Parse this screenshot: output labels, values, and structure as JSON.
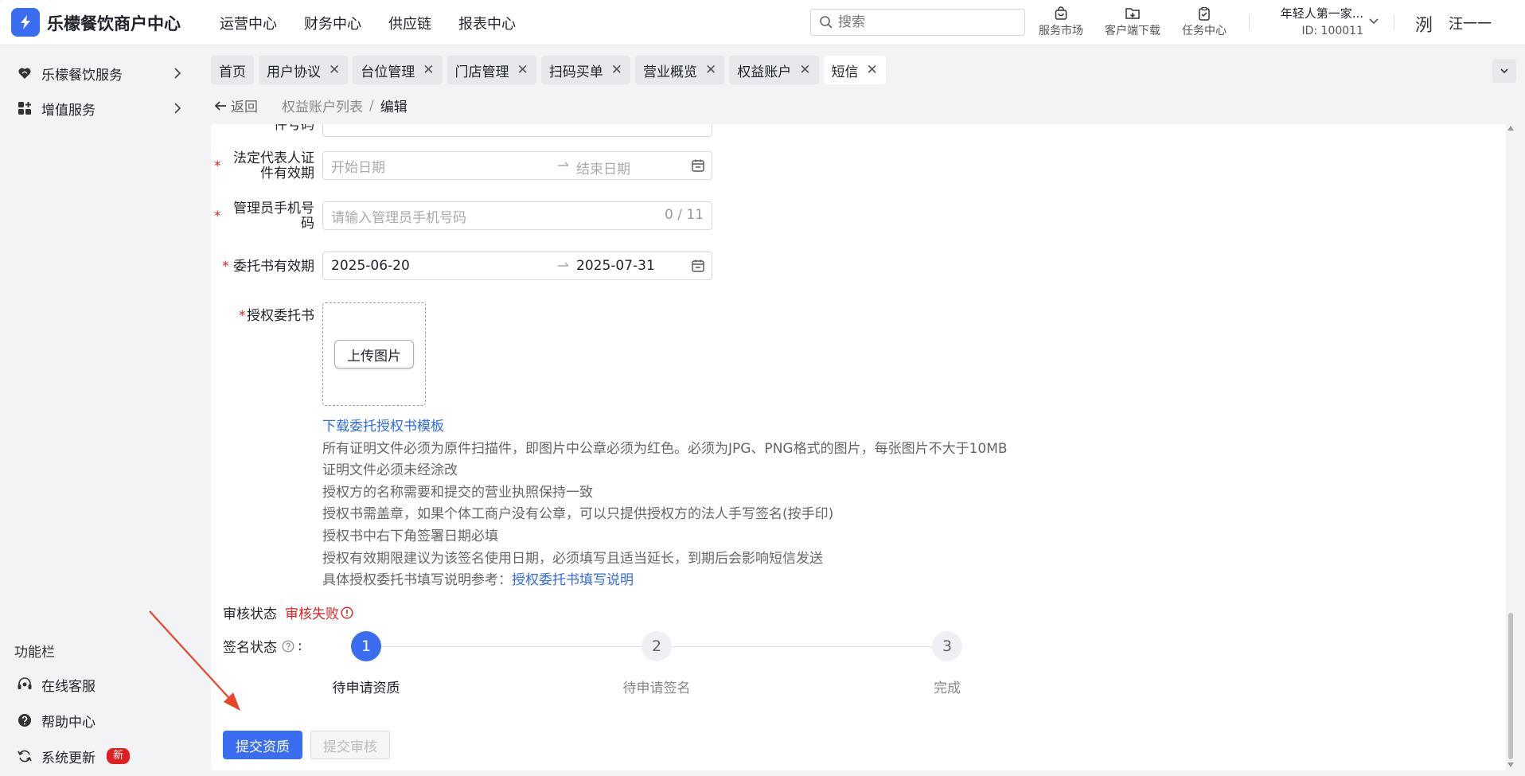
{
  "header": {
    "app_title": "乐檬餐饮商户中心",
    "nav": [
      "运营中心",
      "财务中心",
      "供应链",
      "报表中心"
    ],
    "search_placeholder": "搜索",
    "icons": [
      {
        "label": "服务市场",
        "icon": "shop-bag-icon"
      },
      {
        "label": "客户端下载",
        "icon": "folder-download-icon"
      },
      {
        "label": "任务中心",
        "icon": "clipboard-check-icon"
      }
    ],
    "store_name": "年轻人第一家...",
    "store_id": "ID: 100011",
    "avatar_text": "洌",
    "user_name": "汪一一"
  },
  "sidebar": {
    "items": [
      {
        "label": "乐檬餐饮服务",
        "icon": "service-icon"
      },
      {
        "label": "增值服务",
        "icon": "apps-icon"
      }
    ],
    "func_title": "功能栏",
    "func_items": [
      {
        "label": "在线客服",
        "icon": "customer-service-icon"
      },
      {
        "label": "帮助中心",
        "icon": "help-icon"
      },
      {
        "label": "系统更新",
        "icon": "refresh-icon",
        "badge": "新"
      }
    ]
  },
  "tabs": [
    {
      "label": "首页",
      "closable": false
    },
    {
      "label": "用户协议",
      "closable": true
    },
    {
      "label": "台位管理",
      "closable": true
    },
    {
      "label": "门店管理",
      "closable": true
    },
    {
      "label": "扫码买单",
      "closable": true
    },
    {
      "label": "营业概览",
      "closable": true
    },
    {
      "label": "权益账户",
      "closable": true
    },
    {
      "label": "短信",
      "closable": true,
      "active": true
    }
  ],
  "breadcrumb": {
    "back": "返回",
    "parent": "权益账户列表",
    "separator": "/",
    "current": "编辑"
  },
  "form": {
    "partial_label": "件号码",
    "legal_id_validity": {
      "label_line1": "法定代表人证",
      "label_line2": "件有效期",
      "start_placeholder": "开始日期",
      "end_placeholder": "结束日期"
    },
    "admin_phone": {
      "label_line1": "管理员手机号",
      "label_line2": "码",
      "placeholder": "请输入管理员手机号码",
      "counter": "0 / 11"
    },
    "authorization_validity": {
      "label": "委托书有效期",
      "start": "2025-06-20",
      "end": "2025-07-31"
    },
    "authorization_letter": {
      "label": "授权委托书",
      "upload_button": "上传图片",
      "download_link": "下载委托授权书模板"
    },
    "tips": [
      "所有证明文件必须为原件扫描件，即图片中公章必须为红色。必须为JPG、PNG格式的图片，每张图片不大于10MB",
      "证明文件必须未经涂改",
      "授权方的名称需要和提交的营业执照保持一致",
      "授权书需盖章，如果个体工商户没有公章，可以只提供授权方的法人手写签名(按手印)",
      "授权书中右下角签署日期必填",
      "授权有效期限建议为该签名使用日期，必须填写且适当延长，到期后会影响短信发送"
    ],
    "tip_ref_prefix": "具体授权委托书填写说明参考：",
    "tip_ref_link": "授权委托书填写说明",
    "required_mark": "*"
  },
  "review": {
    "label": "审核状态",
    "value": "审核失败",
    "value_color": "#e02020"
  },
  "sign": {
    "label": "签名状态",
    "colon": ":",
    "steps": [
      {
        "num": "1",
        "label": "待申请资质",
        "state": "active"
      },
      {
        "num": "2",
        "label": "待申请签名",
        "state": "wait"
      },
      {
        "num": "3",
        "label": "完成",
        "state": "wait"
      }
    ]
  },
  "actions": {
    "submit_qualification": "提交资质",
    "submit_review": "提交审核"
  },
  "colors": {
    "primary": "#3a6df0",
    "danger": "#e02020",
    "link": "#2f6bea"
  }
}
